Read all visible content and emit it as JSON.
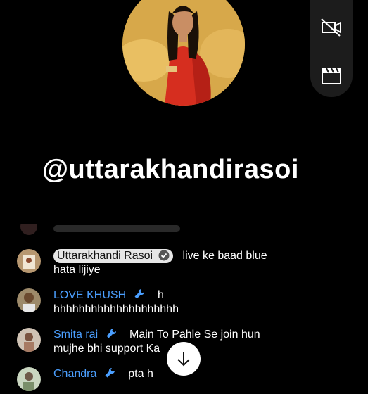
{
  "profile": {
    "handle": "@uttarakhandirasoi"
  },
  "side_controls": [
    {
      "icon": "camera-off-icon"
    },
    {
      "icon": "clapperboard-icon"
    }
  ],
  "chat": {
    "messages": [
      {
        "author": "Uttarakhandi Rasoi",
        "is_owner": true,
        "verified": true,
        "line1": "live ke baad blue",
        "line2": "hata lijiye"
      },
      {
        "author": "LOVE KHUSH",
        "moderator": true,
        "line1": "h",
        "line2": "hhhhhhhhhhhhhhhhhhhh"
      },
      {
        "author": "Smita rai",
        "moderator": true,
        "line1": "Main To Pahle Se join hun",
        "line2": "mujhe bhi support Ka"
      },
      {
        "author": "Chandra",
        "moderator": true,
        "line1": "pta h",
        "line2": ""
      }
    ]
  },
  "colors": {
    "author": "#4b9fff",
    "background": "#000000",
    "panel": "#1c1c1c"
  }
}
